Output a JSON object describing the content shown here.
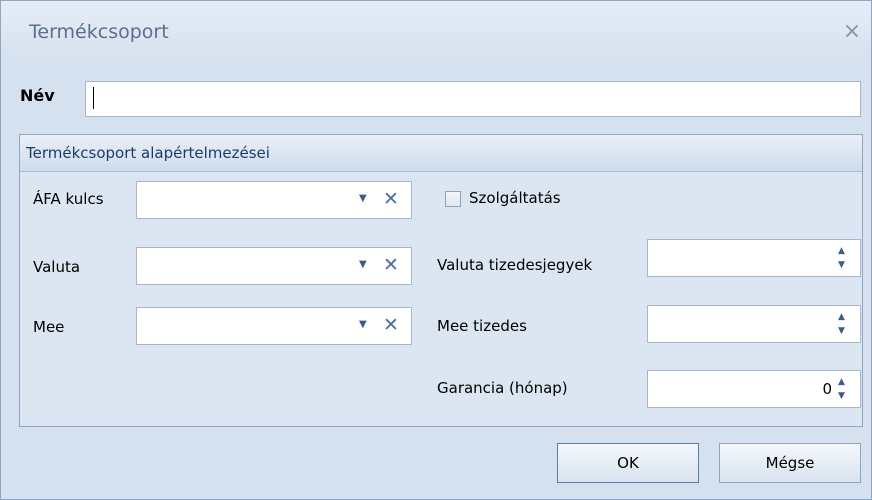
{
  "window": {
    "title": "Termékcsoport",
    "close_glyph": "×"
  },
  "name_field": {
    "label": "Név",
    "value": ""
  },
  "group": {
    "title": "Termékcsoport alapértelmezései",
    "vat": {
      "label": "ÁFA kulcs",
      "value": ""
    },
    "currency": {
      "label": "Valuta",
      "value": ""
    },
    "unit": {
      "label": "Mee",
      "value": ""
    },
    "service": {
      "label": "Szolgáltatás",
      "checked": false
    },
    "currency_decimals": {
      "label": "Valuta tizedesjegyek",
      "value": ""
    },
    "unit_decimals": {
      "label": "Mee tizedes",
      "value": ""
    },
    "warranty": {
      "label": "Garancia (hónap)",
      "value": "0"
    }
  },
  "buttons": {
    "ok": "OK",
    "cancel": "Mégse"
  },
  "icons": {
    "dropdown": "chevron-down-icon",
    "clear": "clear-icon",
    "spin_up": "spin-up-icon",
    "spin_down": "spin-down-icon"
  },
  "colors": {
    "accent": "#1c3c66",
    "border": "#8fa6c4"
  }
}
